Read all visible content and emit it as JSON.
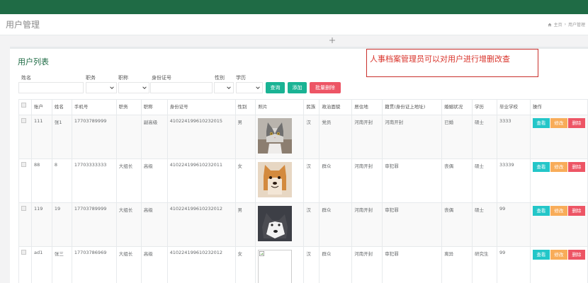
{
  "header": {
    "page_title": "用户管理",
    "breadcrumb": [
      "主页",
      "›",
      "用户管理"
    ]
  },
  "panel": {
    "title": "用户列表"
  },
  "annotation": "人事档案管理员可以对用户进行增删改查",
  "filters": {
    "name_label": "姓名",
    "position_label": "职务",
    "title_label": "职称",
    "idcard_label": "身份证号",
    "gender_label": "性别",
    "education_label": "学历",
    "query_button": "查询",
    "add_button": "添加",
    "batch_delete_button": "批量删除"
  },
  "table": {
    "columns": [
      "",
      "账户",
      "姓名",
      "手机号",
      "职务",
      "职称",
      "身份证号",
      "性别",
      "照片",
      "民族",
      "政治面貌",
      "居住地",
      "籍贯(身份证上地址)",
      "婚姻状况",
      "学历",
      "毕业学校",
      "操作"
    ],
    "rows": [
      {
        "account": "111",
        "name": "张1",
        "phone": "17703789999",
        "position": "",
        "title": "副高级",
        "idcard": "410224199610232015",
        "gender": "男",
        "photo": "gray-white-cat",
        "ethnicity": "汉",
        "politics": "党员",
        "residence": "河南开封",
        "native": "河南开封",
        "marital": "已婚",
        "education": "硕士",
        "school": "3333"
      },
      {
        "account": "88",
        "name": "8",
        "phone": "17703333333",
        "position": "大组长",
        "title": "高级",
        "idcard": "410224199610232011",
        "gender": "女",
        "photo": "shiba-dog",
        "ethnicity": "汉",
        "politics": "群众",
        "residence": "河南开封",
        "native": "审犯罪",
        "marital": "丧偶",
        "education": "硕士",
        "school": "33339"
      },
      {
        "account": "119",
        "name": "19",
        "phone": "17703789999",
        "position": "大组长",
        "title": "高级",
        "idcard": "410224199610232012",
        "gender": "男",
        "photo": "husky-dog",
        "ethnicity": "汉",
        "politics": "群众",
        "residence": "河南开封",
        "native": "审犯罪",
        "marital": "丧偶",
        "education": "硕士",
        "school": "99"
      },
      {
        "account": "ad1",
        "name": "张三",
        "phone": "17703786969",
        "position": "大组长",
        "title": "高级",
        "idcard": "410224199610232012",
        "gender": "女",
        "photo": "broken-image",
        "ethnicity": "汉",
        "politics": "群众",
        "residence": "河南开封",
        "native": "审犯罪",
        "marital": "离异",
        "education": "研究生",
        "school": "99"
      }
    ],
    "action_view": "查看",
    "action_edit": "修改",
    "action_delete": "删除"
  },
  "colors": {
    "topbar": "#1f6b45",
    "accent_green": "#1ab394",
    "danger": "#ed5565",
    "info": "#23c6c8",
    "warning": "#f8ac59",
    "annotation_red": "#d9342b"
  }
}
